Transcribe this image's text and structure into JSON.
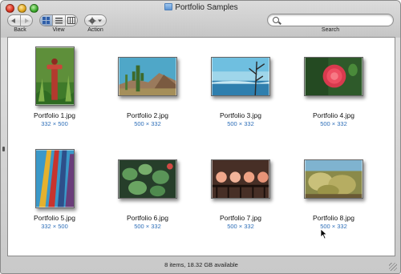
{
  "window": {
    "title": "Portfolio Samples"
  },
  "toolbar": {
    "back_label": "Back",
    "view_label": "View",
    "action_label": "Action",
    "search_label": "Search",
    "search_value": "",
    "search_placeholder": ""
  },
  "files": [
    {
      "name": "Portfolio 1.jpg",
      "dims": "332 × 500"
    },
    {
      "name": "Portfolio 2.jpg",
      "dims": "500 × 332"
    },
    {
      "name": "Portfolio 3.jpg",
      "dims": "500 × 332"
    },
    {
      "name": "Portfolio 4.jpg",
      "dims": "500 × 332"
    },
    {
      "name": "Portfolio 5.jpg",
      "dims": "332 × 500"
    },
    {
      "name": "Portfolio 6.jpg",
      "dims": "500 × 332"
    },
    {
      "name": "Portfolio 7.jpg",
      "dims": "500 × 332"
    },
    {
      "name": "Portfolio 8.jpg",
      "dims": "500 × 332"
    }
  ],
  "status": {
    "text": "8 items, 18.32 GB available"
  },
  "colors": {
    "dims_text": "#2d6eb8",
    "window_metal": "#c9c9c9"
  }
}
